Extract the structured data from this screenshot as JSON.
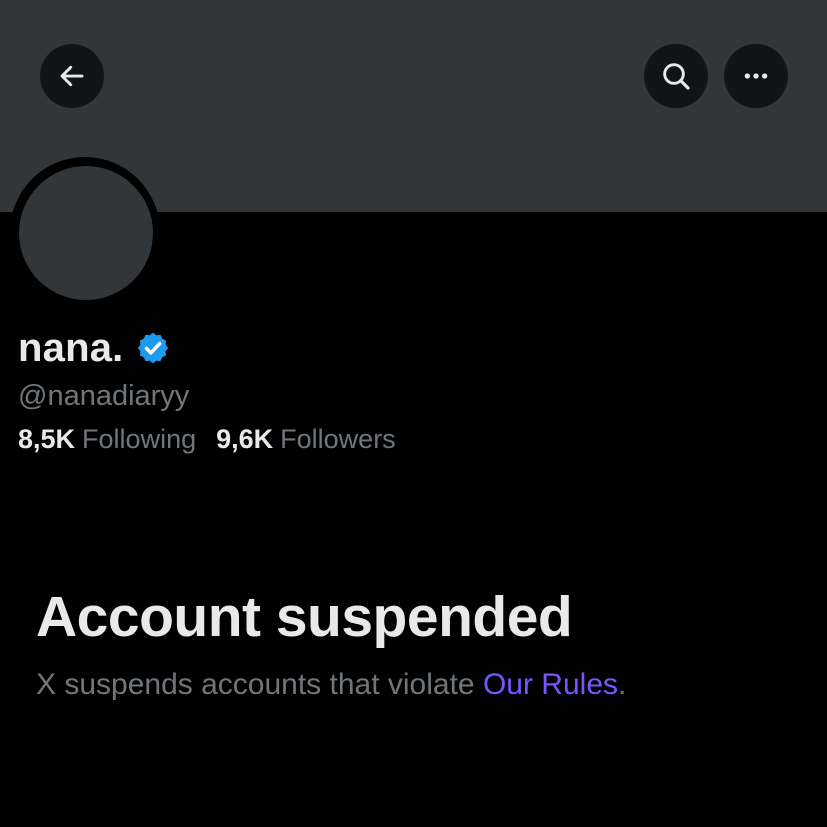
{
  "header": {
    "back_icon": "arrow-left-icon",
    "search_icon": "search-icon",
    "more_icon": "more-horizontal-icon"
  },
  "profile": {
    "display_name": "nana.",
    "verified_icon": "verified-badge-icon",
    "handle": "@nanadiaryy",
    "following_count": "8,5K",
    "following_label": "Following",
    "followers_count": "9,6K",
    "followers_label": "Followers"
  },
  "notice": {
    "title": "Account suspended",
    "text_before": "X suspends accounts that violate ",
    "link_text": "Our Rules",
    "text_after": "."
  },
  "colors": {
    "background": "#000000",
    "banner": "#333639",
    "primary_text": "#e7e9ea",
    "secondary_text": "#71767b",
    "link": "#7856ff",
    "verified": "#1d9bf0"
  }
}
